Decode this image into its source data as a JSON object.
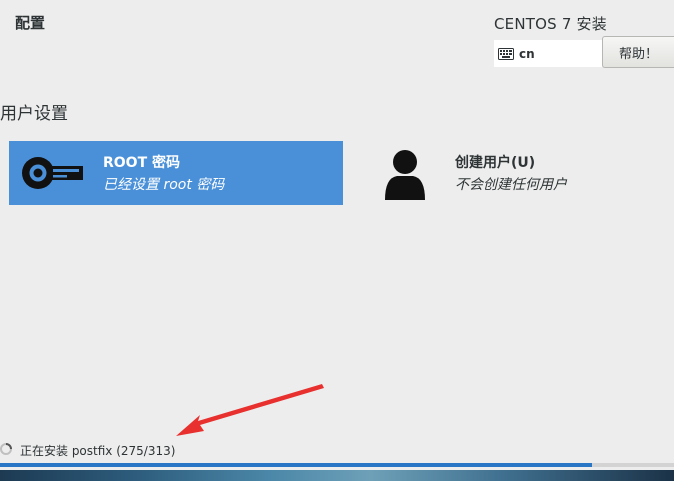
{
  "header": {
    "page_title": "配置",
    "product_title": "CENTOS 7 安装",
    "keyboard_layout": "cn",
    "help_label": "帮助！"
  },
  "user_settings": {
    "heading": "用户设置",
    "spokes": [
      {
        "title": "ROOT 密码",
        "status": "已经设置 root 密码",
        "icon": "key-icon",
        "selected": true
      },
      {
        "title": "创建用户(U)",
        "status": "不会创建任何用户",
        "icon": "user-icon",
        "selected": false
      }
    ]
  },
  "progress": {
    "status_text": "正在安装 postfix (275/313)",
    "current": 275,
    "total": 313
  },
  "colors": {
    "selected_spoke": "#4a90d9",
    "progress_fill": "#2a76c6",
    "annotation_arrow": "#e8302e"
  }
}
